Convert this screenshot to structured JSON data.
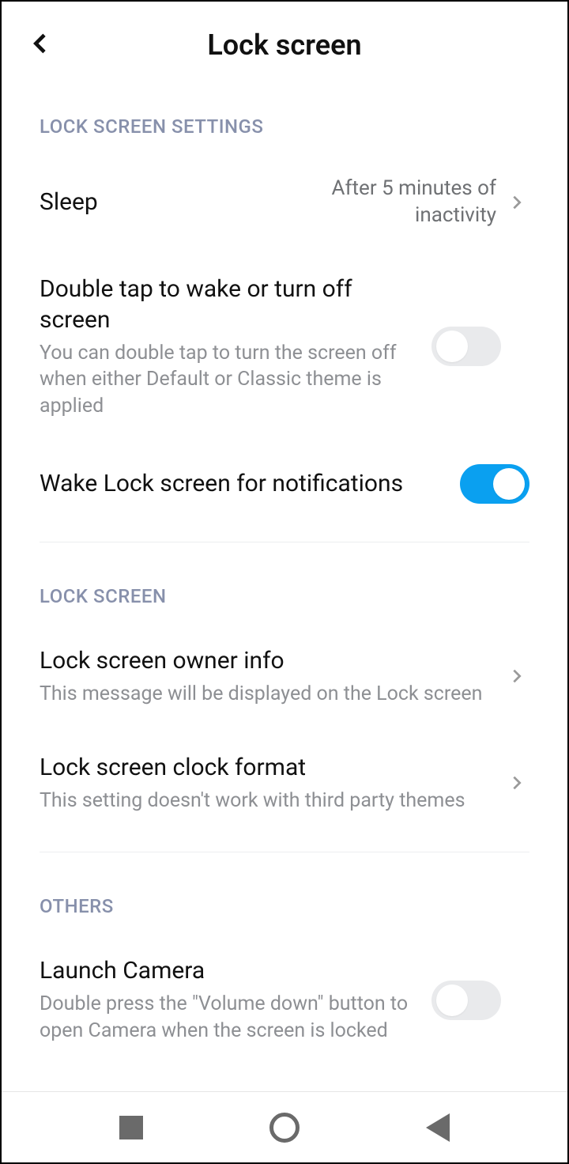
{
  "header": {
    "title": "Lock screen"
  },
  "sections": {
    "settings": {
      "label": "LOCK SCREEN SETTINGS",
      "sleep": {
        "title": "Sleep",
        "value": "After 5 minutes of inactivity"
      },
      "doubleTap": {
        "title": "Double tap to wake or turn off screen",
        "sub": "You can double tap to turn the screen off when either Default or Classic theme is applied",
        "on": false
      },
      "wakeNotif": {
        "title": "Wake Lock screen for notifications",
        "on": true
      }
    },
    "lockscreen": {
      "label": "LOCK SCREEN",
      "ownerInfo": {
        "title": "Lock screen owner info",
        "sub": "This message will be displayed on the Lock screen"
      },
      "clockFormat": {
        "title": "Lock screen clock format",
        "sub": "This setting doesn't work with third party themes"
      }
    },
    "others": {
      "label": "OTHERS",
      "launchCamera": {
        "title": "Launch Camera",
        "sub": "Double press the \"Volume down\" button to open Camera when the screen is locked",
        "on": false
      }
    }
  }
}
